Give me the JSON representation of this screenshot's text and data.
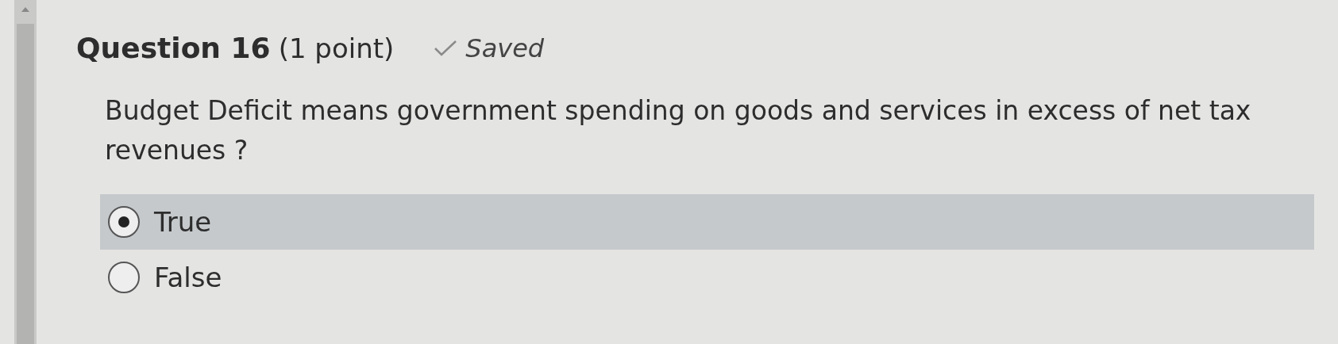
{
  "question": {
    "title": "Question 16",
    "points": "(1 point)",
    "status": "Saved",
    "text": "Budget Deficit means government spending on goods and services in excess of net tax revenues ?"
  },
  "options": [
    {
      "label": "True",
      "selected": true
    },
    {
      "label": "False",
      "selected": false
    }
  ]
}
